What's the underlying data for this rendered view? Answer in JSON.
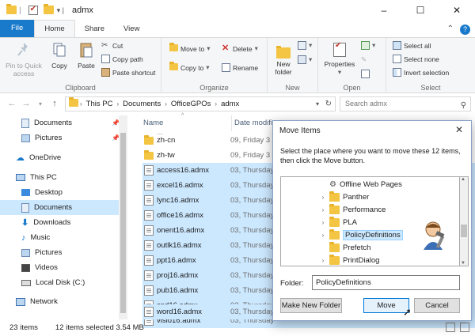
{
  "window": {
    "title": "admx",
    "controls": [
      "–",
      "☐",
      "✕"
    ]
  },
  "ribbon_tabs": [
    "File",
    "Home",
    "Share",
    "View"
  ],
  "ribbon": {
    "clipboard": {
      "pin_label": "Pin to Quick access",
      "copy_label": "Copy",
      "paste_label": "Paste",
      "cut_label": "Cut",
      "copy_path_label": "Copy path",
      "paste_shortcut_label": "Paste shortcut",
      "group_label": "Clipboard"
    },
    "organize": {
      "move_to_label": "Move to",
      "copy_to_label": "Copy to",
      "delete_label": "Delete",
      "rename_label": "Rename",
      "group_label": "Organize"
    },
    "new": {
      "new_folder_label": "New folder",
      "group_label": "New"
    },
    "open": {
      "properties_label": "Properties",
      "group_label": "Open"
    },
    "select": {
      "select_all_label": "Select all",
      "select_none_label": "Select none",
      "invert_label": "Invert selection",
      "group_label": "Select"
    }
  },
  "address": {
    "crumbs": [
      "This PC",
      "Documents",
      "OfficeGPOs",
      "admx"
    ],
    "search_placeholder": "Search admx"
  },
  "nav": {
    "quick": [
      {
        "label": "Documents",
        "pinned": true
      },
      {
        "label": "Pictures",
        "pinned": true
      }
    ],
    "onedrive": "OneDrive",
    "thispc": "This PC",
    "thispc_children": [
      "Desktop",
      "Documents",
      "Downloads",
      "Music",
      "Pictures",
      "Videos",
      "Local Disk (C:)"
    ],
    "network": "Network"
  },
  "filelist": {
    "col_name": "Name",
    "col_date": "Date modifi",
    "partial_top": "...",
    "folders": [
      {
        "name": "zh-cn",
        "date": "09, Friday 3"
      },
      {
        "name": "zh-tw",
        "date": "09, Friday 3"
      }
    ],
    "files": [
      {
        "name": "access16.admx",
        "date": "03, Thursday"
      },
      {
        "name": "excel16.admx",
        "date": "03, Thursday"
      },
      {
        "name": "lync16.admx",
        "date": "03, Thursday"
      },
      {
        "name": "office16.admx",
        "date": "03, Thursday"
      },
      {
        "name": "onent16.admx",
        "date": "03, Thursday"
      },
      {
        "name": "outlk16.admx",
        "date": "03, Thursday"
      },
      {
        "name": "ppt16.admx",
        "date": "03, Thursday"
      },
      {
        "name": "proj16.admx",
        "date": "03, Thursday"
      },
      {
        "name": "pub16.admx",
        "date": "03, Thursday"
      },
      {
        "name": "spd16.admx",
        "date": "03, Thursday"
      },
      {
        "name": "visio16.admx",
        "date": "03, Thursday"
      },
      {
        "name": "word16.admx",
        "date": "03, Thursday"
      }
    ]
  },
  "status": {
    "items": "23 items",
    "selected": "12 items selected 3.54 MB"
  },
  "dialog": {
    "title": "Move Items",
    "message": "Select the place where you want to move these 12 items, then click the Move button.",
    "tree": [
      {
        "label": "Offline Web Pages",
        "icon": "gear-folder-icon",
        "expandable": false
      },
      {
        "label": "Panther",
        "expandable": true
      },
      {
        "label": "Performance",
        "expandable": true
      },
      {
        "label": "PLA",
        "expandable": true
      },
      {
        "label": "PolicyDefinitions",
        "expandable": true,
        "selected": true
      },
      {
        "label": "Prefetch",
        "expandable": false
      },
      {
        "label": "PrintDialog",
        "expandable": true
      }
    ],
    "folder_label": "Folder:",
    "folder_value": "PolicyDefinitions",
    "new_folder_button": "Make New Folder",
    "move_button": "Move",
    "cancel_button": "Cancel"
  },
  "colors": {
    "accent": "#1979ca",
    "selection": "#cce8ff",
    "folder": "#f4c542"
  }
}
